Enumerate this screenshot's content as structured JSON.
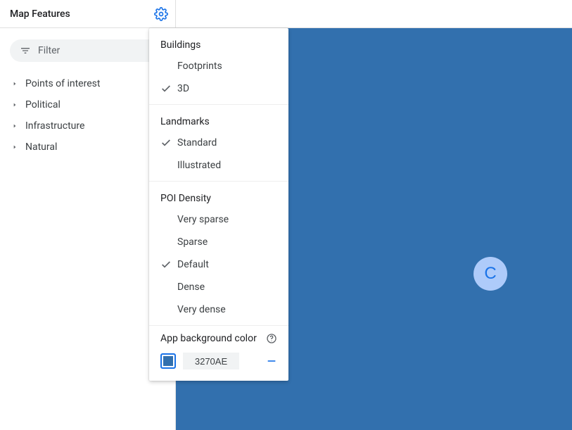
{
  "sidebar": {
    "title": "Map Features",
    "filter_placeholder": "Filter",
    "items": [
      {
        "label": "Points of interest"
      },
      {
        "label": "Political"
      },
      {
        "label": "Infrastructure"
      },
      {
        "label": "Natural"
      }
    ]
  },
  "popover": {
    "sections": [
      {
        "title": "Buildings",
        "options": [
          {
            "label": "Footprints",
            "selected": false
          },
          {
            "label": "3D",
            "selected": true
          }
        ]
      },
      {
        "title": "Landmarks",
        "options": [
          {
            "label": "Standard",
            "selected": true
          },
          {
            "label": "Illustrated",
            "selected": false
          }
        ]
      },
      {
        "title": "POI Density",
        "options": [
          {
            "label": "Very sparse",
            "selected": false
          },
          {
            "label": "Sparse",
            "selected": false
          },
          {
            "label": "Default",
            "selected": true
          },
          {
            "label": "Dense",
            "selected": false
          },
          {
            "label": "Very dense",
            "selected": false
          }
        ]
      }
    ],
    "background": {
      "label": "App background color",
      "hex": "3270AE"
    }
  },
  "canvas": {
    "background_hex": "#3270AE",
    "marker_letter": "C"
  }
}
